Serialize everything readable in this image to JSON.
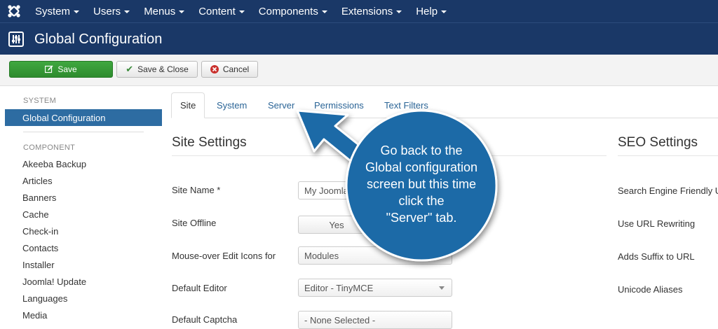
{
  "topnav": {
    "menu": [
      "System",
      "Users",
      "Menus",
      "Content",
      "Components",
      "Extensions",
      "Help"
    ]
  },
  "titlebar": {
    "title": "Global Configuration"
  },
  "toolbar": {
    "save_label": "Save",
    "save_close_label": "Save & Close",
    "cancel_label": "Cancel"
  },
  "sidebar": {
    "system_heading": "SYSTEM",
    "active_item": "Global Configuration",
    "component_heading": "COMPONENT",
    "items": [
      "Akeeba Backup",
      "Articles",
      "Banners",
      "Cache",
      "Check-in",
      "Contacts",
      "Installer",
      "Joomla! Update",
      "Languages",
      "Media"
    ]
  },
  "tabs": [
    "Site",
    "System",
    "Server",
    "Permissions",
    "Text Filters"
  ],
  "site_settings": {
    "title": "Site Settings",
    "site_name_label": "Site Name *",
    "site_name_value": "My Joomla",
    "site_offline_label": "Site Offline",
    "site_offline_value": "Yes",
    "mouseover_label": "Mouse-over Edit Icons for",
    "mouseover_value": "Modules",
    "default_editor_label": "Default Editor",
    "default_editor_value": "Editor - TinyMCE",
    "default_captcha_label": "Default Captcha",
    "default_captcha_value": "- None Selected -"
  },
  "seo_settings": {
    "title": "SEO Settings",
    "labels": [
      "Search Engine Friendly URLs",
      "Use URL Rewriting",
      "Adds Suffix to URL",
      "Unicode Aliases"
    ]
  },
  "callout": {
    "lines": [
      "Go back to the",
      "Global configuration",
      "screen but this time",
      "click the",
      "\"Server\" tab."
    ],
    "color": "#1f6ba7"
  }
}
